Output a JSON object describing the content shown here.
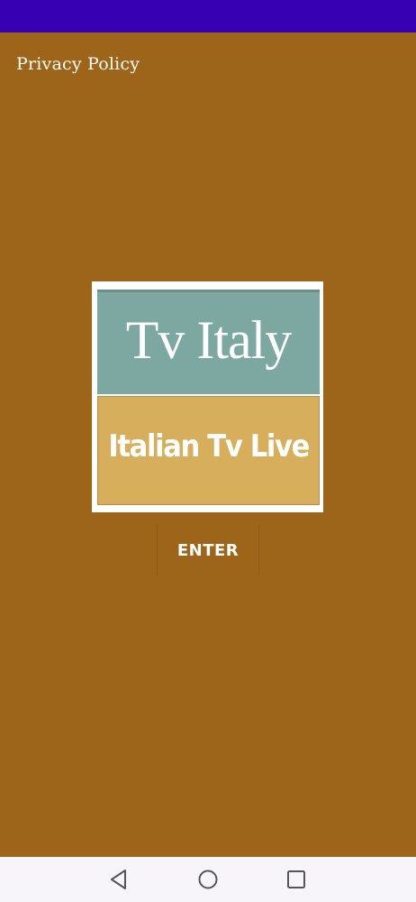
{
  "privacy": {
    "label": "Privacy Policy"
  },
  "logo": {
    "line1": "Tv Italy",
    "line2": "Italian Tv Live"
  },
  "enter": {
    "label": "ENTER"
  },
  "colors": {
    "status_bar": "#3700b3",
    "background": "#9c6519",
    "logo_top": "#7da8a1",
    "logo_bottom": "#d7ae5b",
    "nav_bar": "#f7f5fa"
  },
  "nav": {
    "back_icon": "triangle-back-icon",
    "home_icon": "circle-home-icon",
    "recent_icon": "square-recents-icon"
  }
}
